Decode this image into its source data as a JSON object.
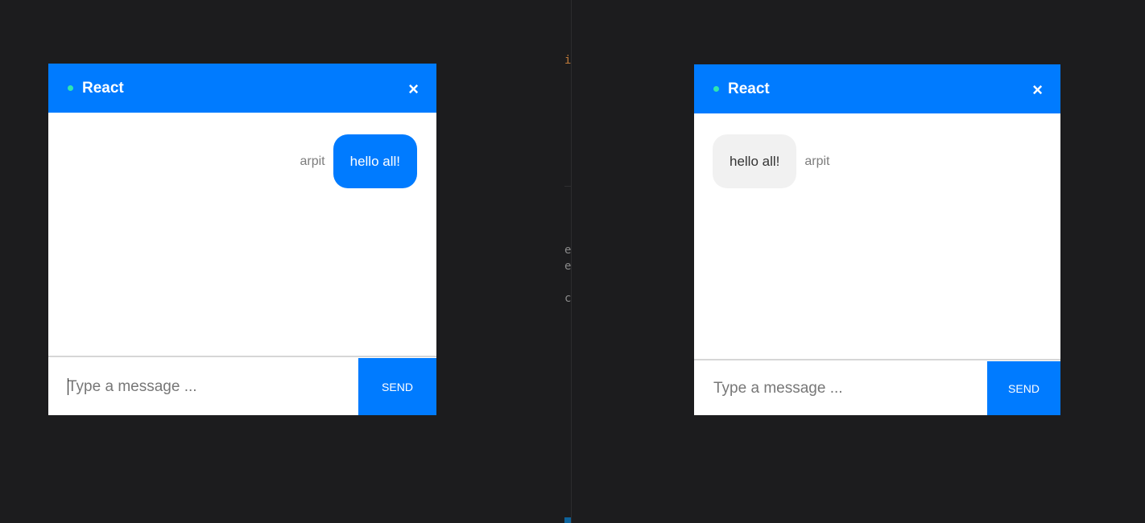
{
  "background_text": {
    "orange_char": "ie",
    "line_1": "e",
    "line_2": "e",
    "line_3": "c"
  },
  "colors": {
    "page_background": "#1c1c1e",
    "accent": "#007bff",
    "status_dot": "#2ee6b0",
    "incoming_bubble": "#f1f1f1"
  },
  "windows": [
    {
      "header": {
        "title": "React",
        "status_icon": "status-dot-icon",
        "close_label": "×"
      },
      "messages": [
        {
          "user": "arpit",
          "text": "hello all!",
          "own": true
        }
      ],
      "input": {
        "placeholder": "Type a message ...",
        "value": ""
      },
      "send_label": "SEND"
    },
    {
      "header": {
        "title": "React",
        "status_icon": "status-dot-icon",
        "close_label": "×"
      },
      "messages": [
        {
          "user": "arpit",
          "text": "hello all!",
          "own": false
        }
      ],
      "input": {
        "placeholder": "Type a message ...",
        "value": ""
      },
      "send_label": "SEND"
    }
  ]
}
